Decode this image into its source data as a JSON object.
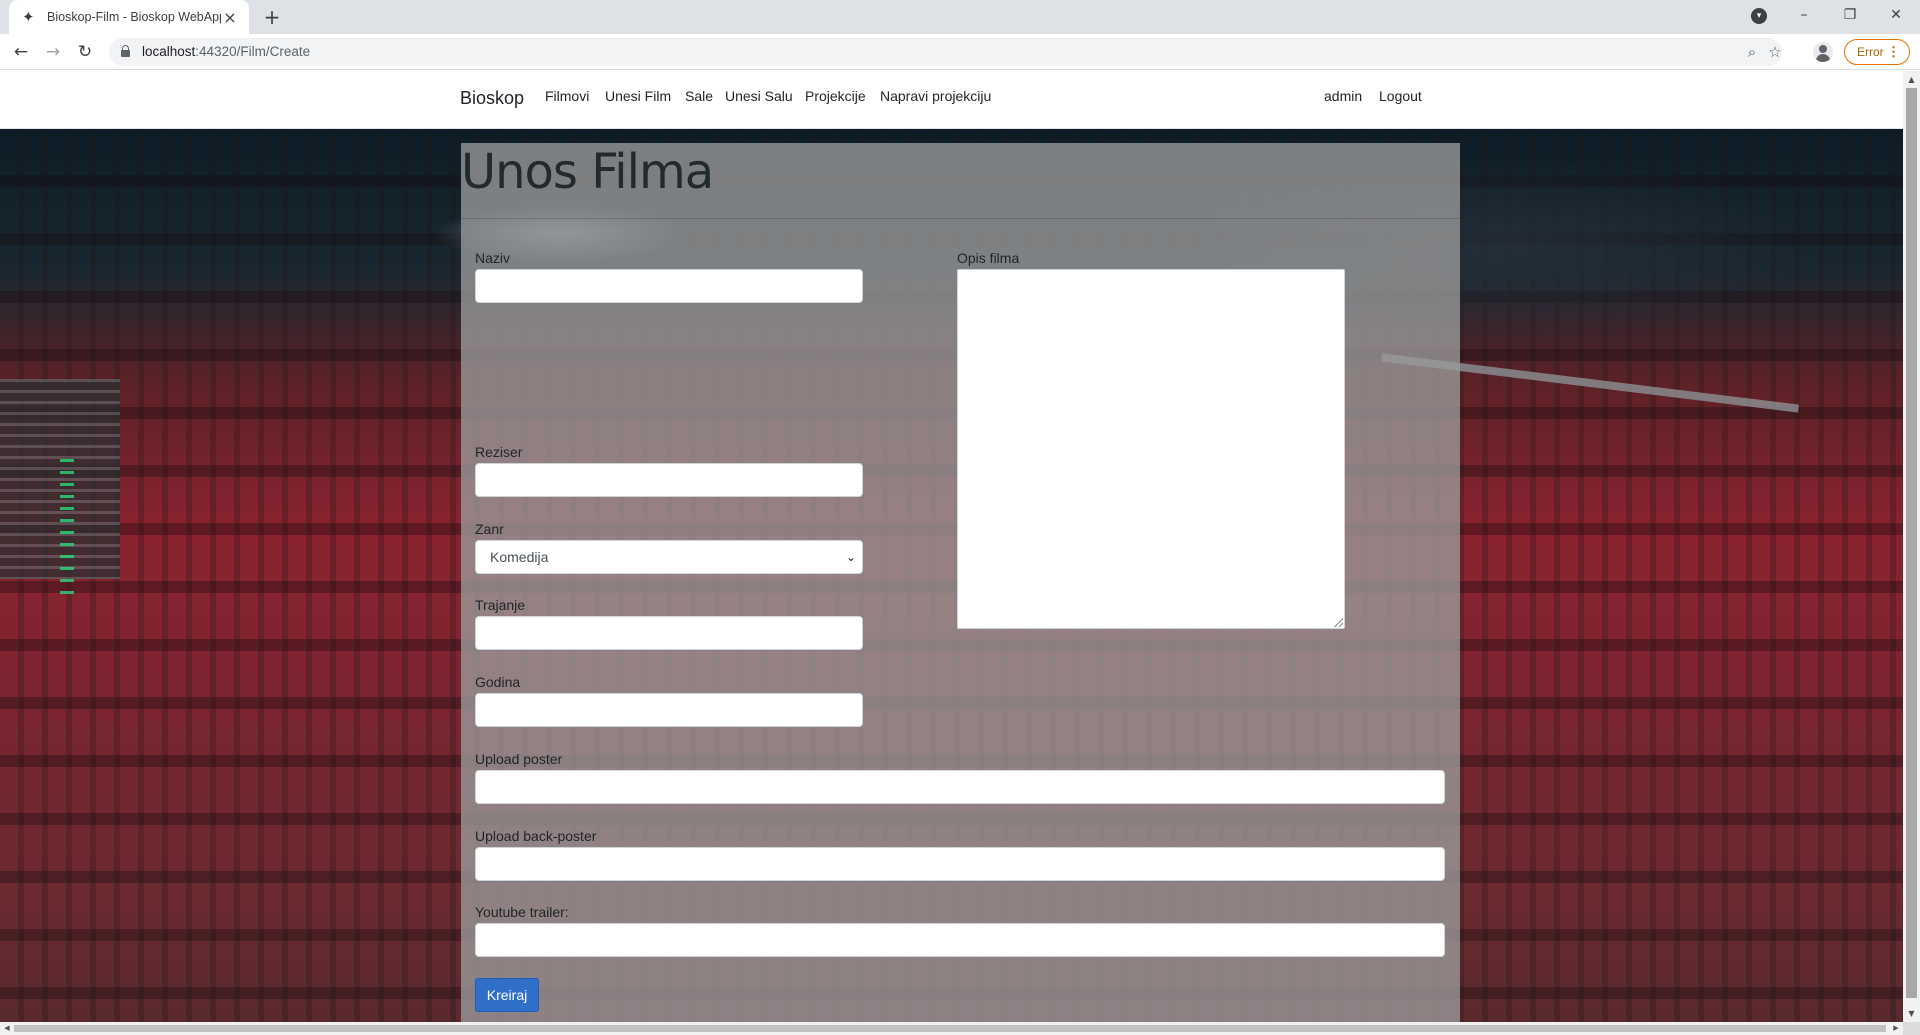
{
  "browser": {
    "tab_title": "Bioskop-Film - Bioskop WebApp",
    "url_host": "localhost",
    "url_path": ":44320/Film/Create",
    "error_label": "Error",
    "icons": {
      "favicon": "star-icon",
      "tab_close": "close-icon",
      "new_tab": "plus-icon",
      "tab_search": "chevron-down-icon",
      "back": "back-arrow-icon",
      "forward": "forward-arrow-icon",
      "reload": "reload-icon",
      "lock": "lock-icon",
      "zoom": "zoom-icon",
      "bookmark": "star-outline-icon",
      "profile": "profile-icon",
      "menu": "kebab-menu-icon"
    }
  },
  "site_nav": {
    "brand": "Bioskop",
    "links": [
      "Filmovi",
      "Unesi Film",
      "Sale",
      "Unesi Salu",
      "Projekcije",
      "Napravi projekciju"
    ],
    "user": "admin",
    "logout": "Logout"
  },
  "form": {
    "title": "Unos Filma",
    "fields": {
      "naziv": {
        "label": "Naziv",
        "value": ""
      },
      "opis": {
        "label": "Opis filma",
        "value": ""
      },
      "reziser": {
        "label": "Reziser",
        "value": ""
      },
      "zanr": {
        "label": "Zanr",
        "selected": "Komedija"
      },
      "trajanje": {
        "label": "Trajanje",
        "value": ""
      },
      "godina": {
        "label": "Godina",
        "value": ""
      },
      "poster": {
        "label": "Upload poster",
        "value": ""
      },
      "back_poster": {
        "label": "Upload back-poster",
        "value": ""
      },
      "trailer": {
        "label": "Youtube trailer:",
        "value": ""
      }
    },
    "submit_label": "Kreiraj"
  },
  "colors": {
    "primary_button": "#2f6fc9",
    "panel_overlay": "rgba(155,155,155,0.78)",
    "error_pill": "#e37400"
  }
}
